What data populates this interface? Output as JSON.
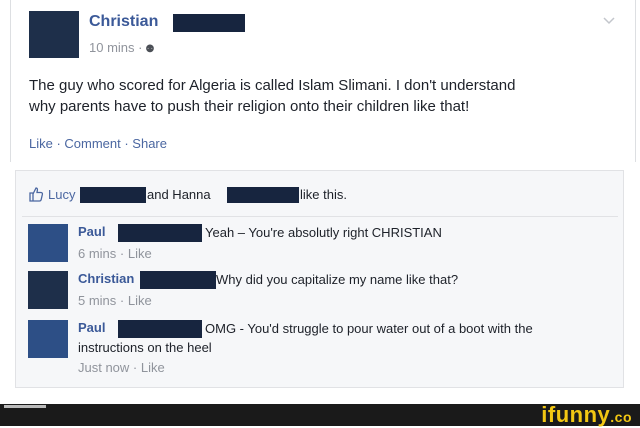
{
  "post": {
    "author": "Christian",
    "time": "10 mins ·",
    "privacy_icon": "friends-icon",
    "text_line1": "The guy who scored for Algeria is called Islam Slimani. I don't understand",
    "text_line2": "why parents have to push their religion onto their children like that!",
    "actions": "Like · Comment · Share"
  },
  "likes": {
    "name1": "Lucy",
    "conjunction": "and Hanna",
    "suffix": "like this."
  },
  "comments": [
    {
      "author": "Paul",
      "text": "Yeah – You're absolutly right CHRISTIAN",
      "time": "6 mins · Like",
      "avatar_color": "#2d4f86"
    },
    {
      "author": "Christian",
      "text": "Why did you capitalize my name like that?",
      "time": "5 mins · Like",
      "avatar_color": "#1e2f4a"
    },
    {
      "author": "Paul",
      "text": "OMG - You'd struggle to pour water out of a boot with the",
      "text2": "instructions on the heel",
      "time": "Just now · Like",
      "avatar_color": "#2d4f86"
    }
  ],
  "watermark": {
    "text": "ifunny",
    "suffix": ".co"
  },
  "colors": {
    "link": "#3b5998",
    "redaction": "#17253f",
    "watermark": "#f2c713"
  }
}
